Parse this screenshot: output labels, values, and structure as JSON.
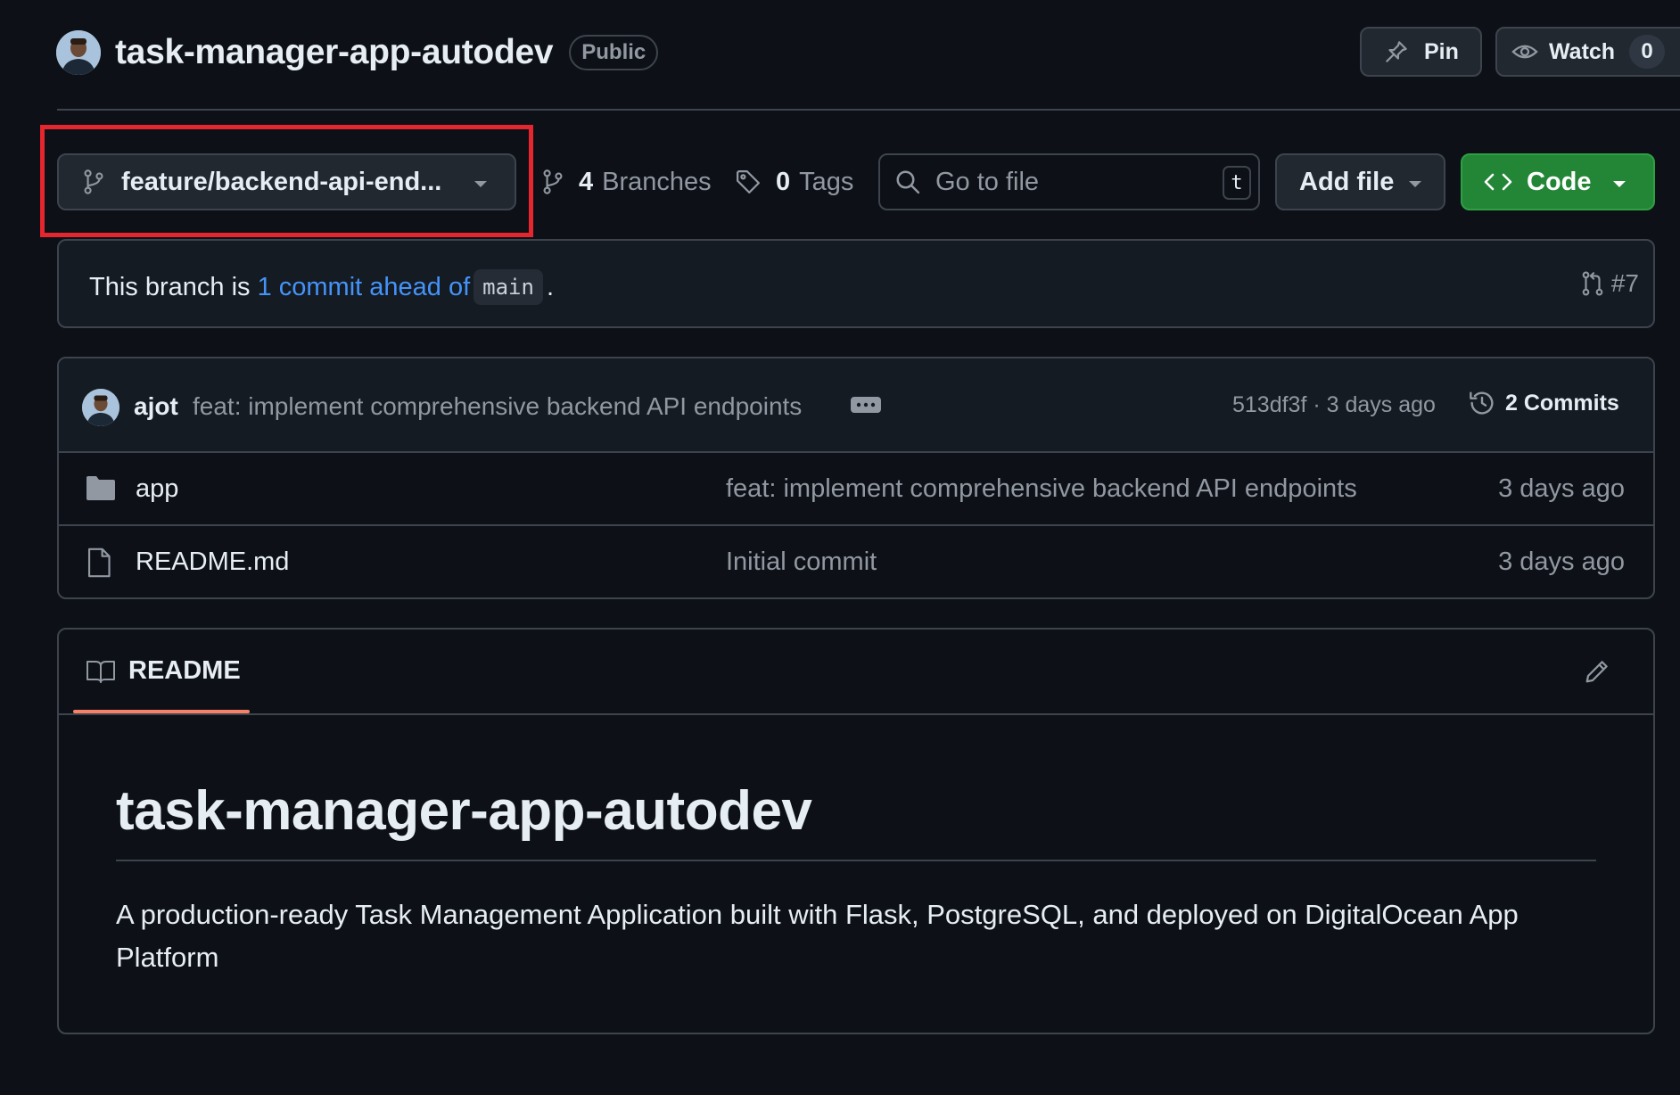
{
  "header": {
    "repo_name": "task-manager-app-autodev",
    "visibility": "Public",
    "pin_label": "Pin",
    "watch_label": "Watch",
    "watch_count": "0"
  },
  "toolbar": {
    "branch_name": "feature/backend-api-end...",
    "branches_count": "4",
    "branches_label": "Branches",
    "tags_count": "0",
    "tags_label": "Tags",
    "search_placeholder": "Go to file",
    "search_shortcut": "t",
    "add_file_label": "Add file",
    "code_label": "Code"
  },
  "ahead_banner": {
    "prefix": "This branch is ",
    "link_text": "1 commit ahead of",
    "base_branch": "main",
    "suffix": ".",
    "pr_number": "#7"
  },
  "latest_commit": {
    "author": "ajot",
    "message": "feat: implement comprehensive backend API endpoints",
    "sha_and_time": "513df3f · 3 days ago",
    "commits_label": "2 Commits"
  },
  "files": [
    {
      "name": "app",
      "type": "folder",
      "message": "feat: implement comprehensive backend API endpoints",
      "date": "3 days ago"
    },
    {
      "name": "README.md",
      "type": "file",
      "message": "Initial commit",
      "date": "3 days ago"
    }
  ],
  "readme": {
    "tab_label": "README",
    "title": "task-manager-app-autodev",
    "body": "A production-ready Task Management Application built with Flask, PostgreSQL, and deployed on DigitalOcean App Platform"
  },
  "colors": {
    "background": "#0d1117",
    "accent_link": "#4493f8",
    "code_button": "#238636",
    "highlight_box": "#e5262f",
    "tab_underline": "#f78166"
  }
}
